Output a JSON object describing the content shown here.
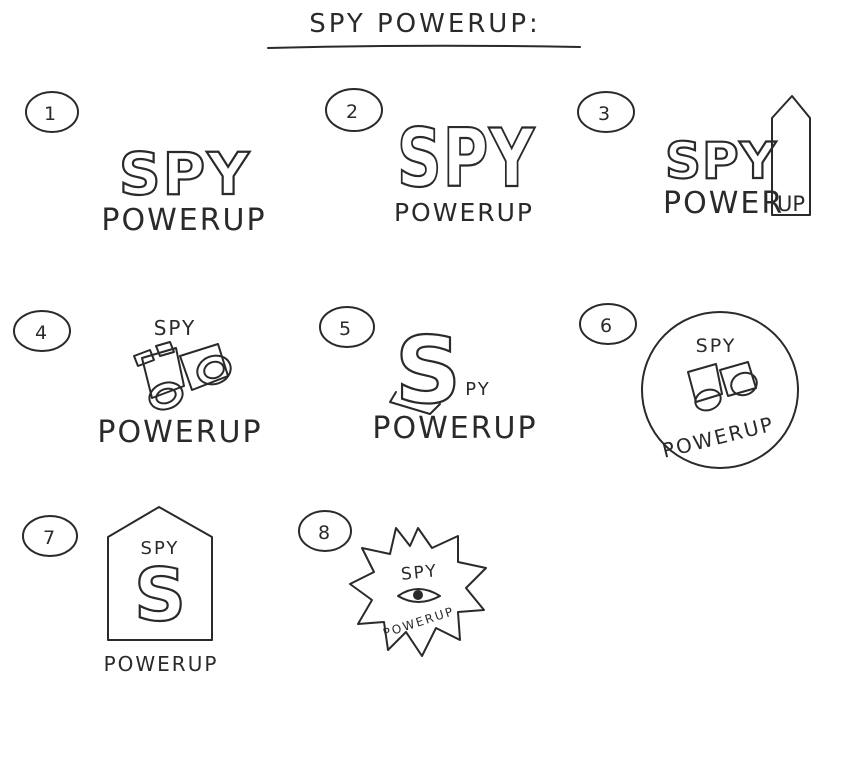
{
  "page": {
    "title": "SPY POWERUP:"
  },
  "sketches": [
    {
      "number": "1",
      "line1": "SPY",
      "line2": "POWERUP"
    },
    {
      "number": "2",
      "line1": "SPY",
      "line2": "POWERUP"
    },
    {
      "number": "3",
      "line1": "SPY",
      "line2": "POWER",
      "line2b": "UP"
    },
    {
      "number": "4",
      "line1": "SPY",
      "line2": "POWERUP",
      "icon": "binoculars-icon"
    },
    {
      "number": "5",
      "line1": "S",
      "line1b": "PY",
      "line2": "POWERUP"
    },
    {
      "number": "6",
      "line1": "SPY",
      "line2": "POWERUP",
      "icon": "binoculars-icon"
    },
    {
      "number": "7",
      "line1": "SPY",
      "line1b": "S",
      "line2": "POWERUP"
    },
    {
      "number": "8",
      "line1": "SPY",
      "line2": "POWERUP",
      "icon": "eye-icon"
    }
  ]
}
